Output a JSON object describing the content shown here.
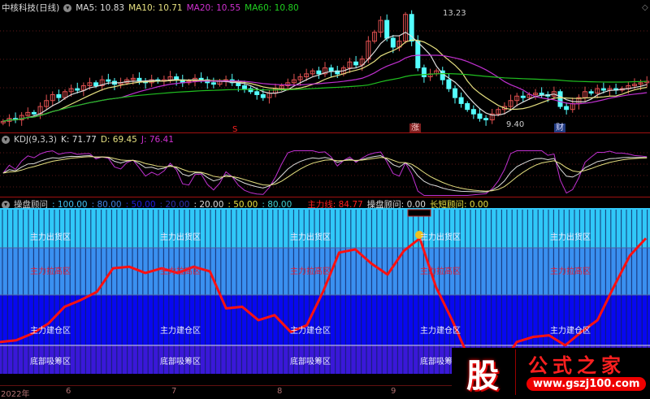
{
  "price_header": {
    "title": "中核科技(日线)",
    "ma5": "MA5: 10.83",
    "ma10": "MA10: 10.71",
    "ma20": "MA20: 10.55",
    "ma60": "MA60: 10.80"
  },
  "price_annotations": {
    "high": "13.23",
    "low": "9.40",
    "marker_s": "S",
    "marker_zhang": "涨",
    "marker_cai": "财"
  },
  "kdj_header": {
    "name": "KDJ(9,3,3)",
    "k": "K: 71.77",
    "d": "D: 69.45",
    "j": "J: 76.41"
  },
  "ind_header": {
    "name": "操盘顾问",
    "v1": ": 100.00",
    "v2": ": 80.00",
    "v3": ": 50.00",
    "v4": ": 20.00",
    "v5": ": 20.00",
    "v6": ": 50.00",
    "v7": ": 80.00",
    "main": "主力线: 84.77",
    "advisor": "操盘顾问: 0.00",
    "longshort": "长短顾问: 0.00"
  },
  "zones": {
    "top": "主力出货区",
    "upper": "主力拉高区",
    "mid": "主力建仓区",
    "bottom": "底部吸筹区"
  },
  "axis": {
    "y2022": "2022年",
    "m6": "6",
    "m7": "7",
    "m8": "8",
    "m9": "9"
  },
  "logo": {
    "char": "股",
    "name": "公式之家",
    "url": "www.gszj100.com"
  },
  "colors": {
    "up": "#e05050",
    "down": "#54ffff",
    "ma5": "#dddddd",
    "ma10": "#e6e080",
    "ma20": "#c030d0",
    "ma60": "#20c020",
    "main_line": "#ff1010"
  },
  "chart_data": {
    "type": "line",
    "price_closes": [
      9.5,
      9.6,
      9.55,
      9.7,
      9.8,
      9.75,
      10.0,
      10.2,
      10.4,
      10.3,
      10.5,
      10.6,
      10.55,
      10.7,
      10.8,
      10.7,
      10.9,
      10.85,
      10.75,
      10.8,
      10.9,
      10.95,
      10.85,
      10.8,
      10.9,
      10.85,
      10.9,
      11.0,
      10.9,
      10.8,
      10.85,
      10.95,
      10.9,
      10.8,
      10.75,
      10.85,
      10.9,
      10.8,
      10.7,
      10.6,
      10.5,
      10.4,
      10.3,
      10.45,
      10.6,
      10.7,
      10.8,
      10.9,
      11.0,
      11.1,
      11.2,
      11.1,
      11.3,
      11.2,
      11.1,
      11.3,
      11.5,
      11.4,
      11.6,
      12.2,
      12.5,
      12.9,
      12.3,
      12.0,
      12.2,
      13.1,
      12.2,
      11.3,
      11.0,
      11.1,
      11.2,
      10.9,
      10.6,
      10.3,
      10.1,
      9.9,
      9.75,
      9.6,
      9.55,
      9.75,
      9.9,
      10.0,
      10.2,
      10.35,
      10.3,
      10.4,
      10.45,
      10.4,
      10.35,
      10.5,
      10.0,
      9.9,
      10.1,
      10.3,
      10.5,
      10.45,
      10.6,
      10.55,
      10.6,
      10.55,
      10.6,
      10.7,
      10.75,
      10.8,
      10.85
    ],
    "main_line_values": [
      22,
      23,
      27,
      33,
      43,
      47,
      52,
      67,
      68,
      64,
      67,
      64,
      68,
      65,
      42,
      43,
      35,
      38,
      28,
      32,
      52,
      77,
      79,
      70,
      63,
      78,
      85,
      55,
      35,
      12,
      0,
      5,
      22,
      25,
      26,
      20,
      28,
      35,
      55,
      75,
      85
    ],
    "main_line_range": [
      0,
      100
    ],
    "zone_levels": [
      100,
      80,
      50,
      20,
      0
    ]
  }
}
